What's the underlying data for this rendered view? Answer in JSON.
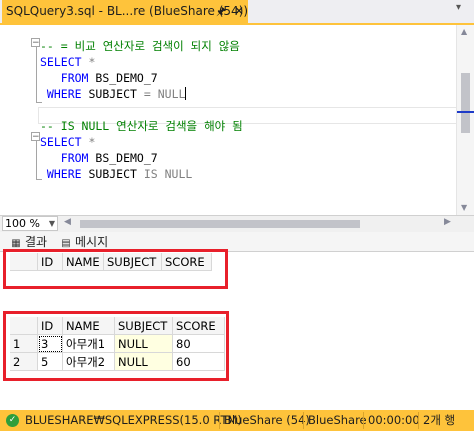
{
  "tab": {
    "title": "SQLQuery3.sql - BL...re (BlueShare (54))*",
    "pin_icon": "pin-icon",
    "close_icon": "close-icon"
  },
  "editor": {
    "lines": [
      {
        "parts": [
          {
            "t": "-- = 비교 연산자로 검색이 되지 않음",
            "c": "cm"
          }
        ]
      },
      {
        "parts": [
          {
            "t": "SELECT",
            "c": "kw"
          },
          {
            "t": " *",
            "c": "gr"
          }
        ]
      },
      {
        "parts": [
          {
            "t": "   FROM",
            "c": "kw"
          },
          {
            "t": " BS_DEMO_7",
            "c": "tx"
          }
        ]
      },
      {
        "parts": [
          {
            "t": " WHERE",
            "c": "kw"
          },
          {
            "t": " SUBJECT ",
            "c": "tx"
          },
          {
            "t": "=",
            "c": "gr"
          },
          {
            "t": " NULL",
            "c": "gr"
          }
        ]
      },
      {
        "parts": [
          {
            "t": "",
            "c": "tx"
          }
        ]
      },
      {
        "parts": [
          {
            "t": "-- IS NULL 연산자로 검색을 해야 됨",
            "c": "cm"
          }
        ]
      },
      {
        "parts": [
          {
            "t": "SELECT",
            "c": "kw"
          },
          {
            "t": " *",
            "c": "gr"
          }
        ]
      },
      {
        "parts": [
          {
            "t": "   FROM",
            "c": "kw"
          },
          {
            "t": " BS_DEMO_7",
            "c": "tx"
          }
        ]
      },
      {
        "parts": [
          {
            "t": " WHERE",
            "c": "kw"
          },
          {
            "t": " SUBJECT ",
            "c": "tx"
          },
          {
            "t": "IS NULL",
            "c": "gr"
          }
        ]
      }
    ]
  },
  "zoom": {
    "value": "100 %"
  },
  "results_tabs": {
    "results_label": "결과",
    "messages_label": "메시지"
  },
  "result1": {
    "columns": [
      "ID",
      "NAME",
      "SUBJECT",
      "SCORE"
    ]
  },
  "result2": {
    "columns": [
      "ID",
      "NAME",
      "SUBJECT",
      "SCORE"
    ],
    "rows": [
      {
        "num": "1",
        "id": "3",
        "name": "아무개1",
        "subject": "NULL",
        "score": "80"
      },
      {
        "num": "2",
        "id": "5",
        "name": "아무개2",
        "subject": "NULL",
        "score": "60"
      }
    ]
  },
  "status": {
    "icon": "check-icon",
    "server": "BLUESHARE₩SQLEXPRESS(15.0 RTM)",
    "login": "BlueShare (54)",
    "database": "BlueShare",
    "elapsed": "00:00:00",
    "rows": "2개 행"
  },
  "colors": {
    "accent": "#fec33b",
    "highlight_box": "#e8202b",
    "keyword": "#0000ff",
    "comment": "#008000"
  }
}
